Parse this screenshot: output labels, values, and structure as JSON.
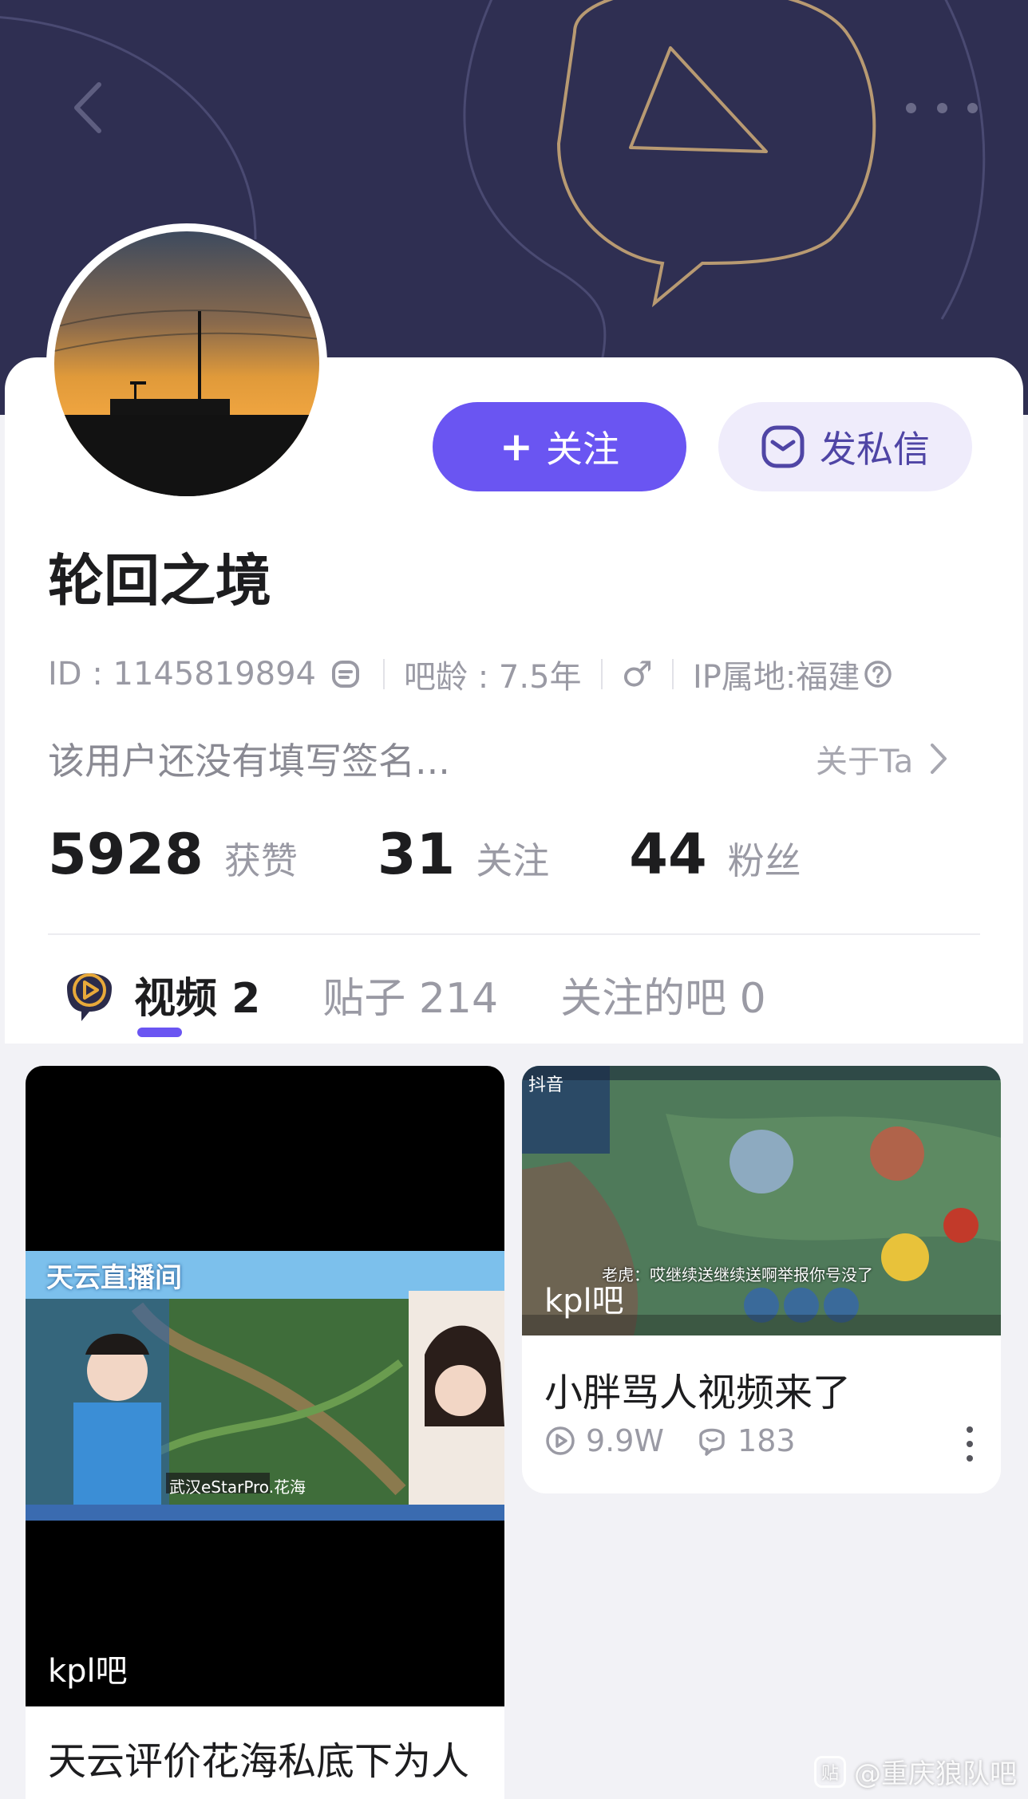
{
  "header": {
    "back_icon": "chevron-left-icon",
    "more_icon": "more-dots-icon"
  },
  "profile": {
    "name": "轮回之境",
    "follow_label": "关注",
    "follow_prefix": "+",
    "message_label": "发私信",
    "id_text": "ID : 1145819894",
    "bar_age_text": "吧龄 : 7.5年",
    "gender": "♂",
    "ip_text": "IP属地:福建",
    "bio": "该用户还没有填写签名...",
    "about_label": "关于Ta"
  },
  "stats": [
    {
      "value": "5928",
      "label": "获赞"
    },
    {
      "value": "31",
      "label": "关注"
    },
    {
      "value": "44",
      "label": "粉丝"
    }
  ],
  "tabs": [
    {
      "label": "视频 2",
      "active": true
    },
    {
      "label": "贴子 214",
      "active": false
    },
    {
      "label": "关注的吧 0",
      "active": false
    }
  ],
  "videos": [
    {
      "bar_tag": "kpl吧",
      "title": "天云评价花海私底下为人",
      "overlay_title": "天云直播间",
      "overlay_caption": "武汉eStarPro.花海"
    },
    {
      "bar_tag": "kpl吧",
      "title": "小胖骂人视频来了",
      "views": "9.9W",
      "comments": "183",
      "overlay_source": "抖音",
      "overlay_caption": "老虎：哎继续送继续送啊举报你号没了"
    }
  ],
  "watermark": "@重庆狼队吧",
  "colors": {
    "accent": "#6a55f2",
    "header_bg": "#2f2f52",
    "header_line": "#b89a72"
  }
}
